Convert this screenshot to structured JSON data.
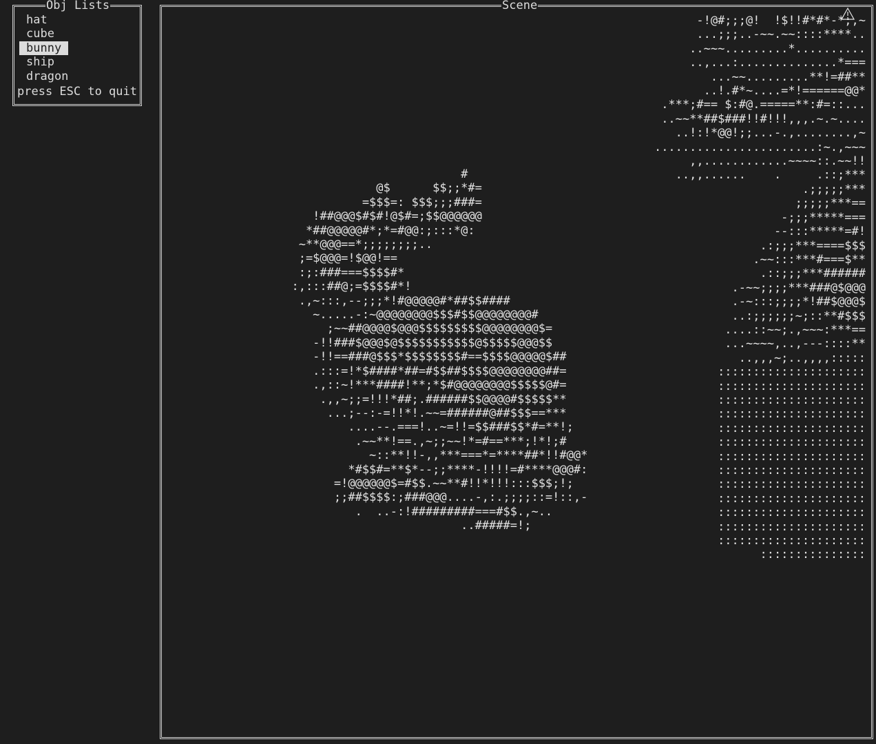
{
  "obj_panel": {
    "title": "Obj Lists",
    "items": [
      "hat",
      "cube",
      "bunny",
      "ship",
      "dragon"
    ],
    "selected": "bunny",
    "quit_hint": "press ESC to quit"
  },
  "scene_panel": {
    "title": "Scene",
    "bunny_ascii": "                          #\n              @$      $$;;*#=\n            =$$$=: $$$;;;###=\n     !##@@@$#$#!@$#=;$$@@@@@@\n    *##@@@@@#*;*=#@@:;:::*@:\n   ~**@@@==*;;;;;;;;..\n   ;=$@@@=!$@@!==\n   :;:###===$$$$#*\n  :,:::##@;=$$$$#*!\n   .,~:::,--;;;*!#@@@@@#*##$$####\n     ~.....-:~@@@@@@@@$$$#$$@@@@@@@@#\n       ;~~##@@@@$@@@$$$$$$$$$@@@@@@@@$=\n     -!!###$@@@$@$$$$$$$$$$$@$$$$$@@@$$\n     -!!==###@$$$*$$$$$$$$#==$$$$@@@@@$##\n     .:::=!*$####*##=#$$##$$$$@@@@@@@@##=\n     .,::~!***####!**;*$#@@@@@@@@$$$$$@#=\n      .,,~;;=!!!*##;.######$$@@@@#$$$$$**\n       ...;--:-=!!*!.~~=######@##$$$==***\n          ....--.===!..~=!!=$$###$$*#=**!;\n           .~~**!==.,~;;~~!*=#==***;!*!;#\n             ~::**!!-,,***===*=****##*!!#@@*\n          *#$$#=**$*--;;****-!!!!=#****@@@#:\n        =!@@@@@@$=#$$.~~**#!!*!!!:::$$$;!;\n        ;;##$$$$:;###@@@....-,:.;;;;::=!::,-\n           .  ..-:!#########===#$$.,~..\n                          ..#####=!;",
    "dragon_ascii": "-!@#;;;@!  !$!!#*#*-*;,~\n...;;;..-~~.~~::::****..\n..~~~.........*..........\n..,...:..............*===\n...~~.........**!=##**\n..!.#*~....=*!======@@*\n.***;#== $:#@.=====**:#=::...\n..~~**##$###!!#!!!,,,.~.~....\n..!:!*@@!;;...-.,........,~\n.......................:~.,~~~\n,,............~~~~::.~~!!\n..,,......    .     .::;***\n.;;;;;***\n;;;;;***==\n-;;;*****===\n--:::*****=#!\n.:;;;***====$$$\n.~~:::***#===$**\n.::;;;***######\n.-~~;;;;***###@$@@@\n.-~:::;;;;*!##$@@@$\n..:;;;;;;~;::**#$$$\n....::~~;.,~~~:***==\n...~~~~,..,---::::**\n..,,,~;..,,,,:::::\n:::::::::::::::::::::\n:::::::::::::::::::::\n:::::::::::::::::::::\n:::::::::::::::::::::\n:::::::::::::::::::::\n:::::::::::::::::::::\n:::::::::::::::::::::\n:::::::::::::::::::::\n:::::::::::::::::::::\n:::::::::::::::::::::\n:::::::::::::::::::::\n:::::::::::::::::::::\n:::::::::::::::::::::\n:::::::::::::::"
  }
}
